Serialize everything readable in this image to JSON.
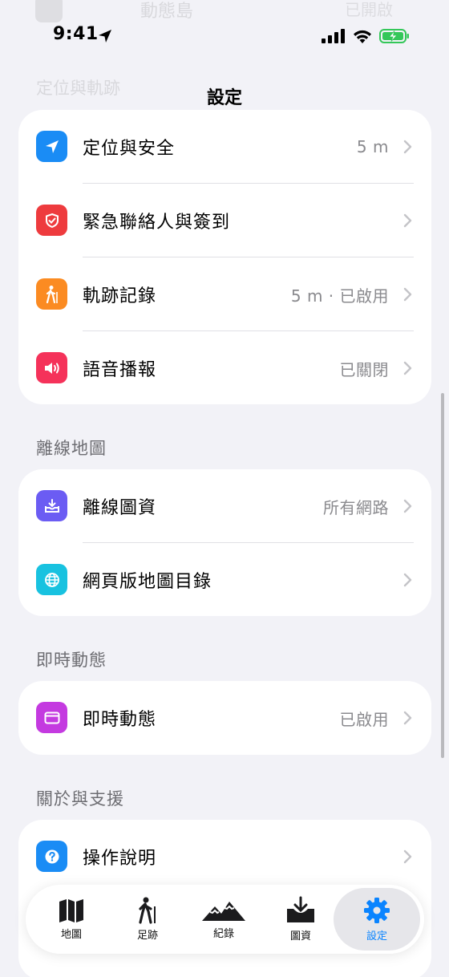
{
  "status_bar": {
    "time": "9:41"
  },
  "ghost": {
    "label": "動態島",
    "value": "已開啟",
    "section": "定位與軌跡"
  },
  "nav": {
    "title": "設定"
  },
  "groups": [
    {
      "header": "",
      "rows": [
        {
          "label": "定位與安全",
          "value": "5 m",
          "icon": "location-arrow-icon",
          "color": "#1a8cf5"
        },
        {
          "label": "緊急聯絡人與簽到",
          "value": "",
          "icon": "shield-check-icon",
          "color": "#ee3b3e"
        },
        {
          "label": "軌跡記錄",
          "value": "5 m · 已啟用",
          "icon": "hiker-icon",
          "color": "#fb8b22"
        },
        {
          "label": "語音播報",
          "value": "已關閉",
          "icon": "speaker-icon",
          "color": "#f5325a"
        }
      ]
    },
    {
      "header": "離線地圖",
      "rows": [
        {
          "label": "離線圖資",
          "value": "所有網路",
          "icon": "download-tray-icon",
          "color": "#6b5cf3"
        },
        {
          "label": "網頁版地圖目錄",
          "value": "",
          "icon": "globe-icon",
          "color": "#18c2e0"
        }
      ]
    },
    {
      "header": "即時動態",
      "rows": [
        {
          "label": "即時動態",
          "value": "已啟用",
          "icon": "live-activity-icon",
          "color": "#c43ae0"
        }
      ]
    },
    {
      "header": "關於與支援",
      "rows": [
        {
          "label": "操作說明",
          "value": "",
          "icon": "question-icon",
          "color": "#1a8cf5"
        }
      ]
    }
  ],
  "tabs": [
    {
      "label": "地圖",
      "icon": "map-icon",
      "active": false
    },
    {
      "label": "足跡",
      "icon": "hiker-icon",
      "active": false
    },
    {
      "label": "紀錄",
      "icon": "mountains-icon",
      "active": false
    },
    {
      "label": "圖資",
      "icon": "download-tray-icon",
      "active": false
    },
    {
      "label": "設定",
      "icon": "gear-icon",
      "active": true
    }
  ],
  "colors": {
    "accent": "#0a84ff",
    "battery": "#34c759"
  }
}
